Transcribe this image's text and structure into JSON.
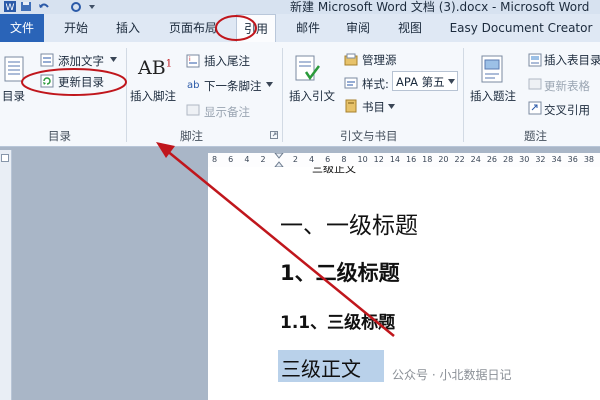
{
  "window": {
    "title": "新建 Microsoft Word 文档 (3).docx  -  Microsoft Word"
  },
  "tabs": {
    "file": "文件",
    "home": "开始",
    "insert": "插入",
    "layout": "页面布局",
    "references": "引用",
    "mailings": "邮件",
    "review": "审阅",
    "view": "视图",
    "easy": "Easy Document Creator"
  },
  "ribbon": {
    "toc": {
      "toc_button": "目录",
      "add_text": "添加文字",
      "update_toc": "更新目录",
      "group": "目录"
    },
    "footnotes": {
      "insert_footnote": "插入脚注",
      "insert_endnote": "插入尾注",
      "next_footnote": "下一条脚注",
      "show_notes": "显示备注",
      "group": "脚注",
      "ab_glyph": "AB"
    },
    "citations": {
      "insert_citation": "插入引文",
      "manage_sources": "管理源",
      "style_label": "样式:",
      "style_value": "APA 第五",
      "bibliography": "书目",
      "group": "引文与书目"
    },
    "captions": {
      "insert_caption": "插入题注",
      "insert_table_of_figures": "插入表目录",
      "update_table": "更新表格",
      "cross_reference": "交叉引用",
      "group": "题注"
    }
  },
  "ruler": {
    "ticks": [
      "8",
      "6",
      "4",
      "2",
      "",
      "2",
      "4",
      "6",
      "8",
      "10",
      "12",
      "14",
      "16",
      "18",
      "20",
      "22",
      "24",
      "26",
      "28",
      "30",
      "32",
      "34",
      "36",
      "38"
    ]
  },
  "document": {
    "top_cut_text": "三级正文",
    "h1": "一、一级标题",
    "h2": "1、二级标题",
    "h3": "1.1、三级标题",
    "body": "三级正文"
  },
  "watermark": "公众号 · 小北数据日记",
  "colors": {
    "file_tab": "#2a64b8",
    "annotation_red": "#c0161c",
    "selection": "#b9d1ea"
  }
}
